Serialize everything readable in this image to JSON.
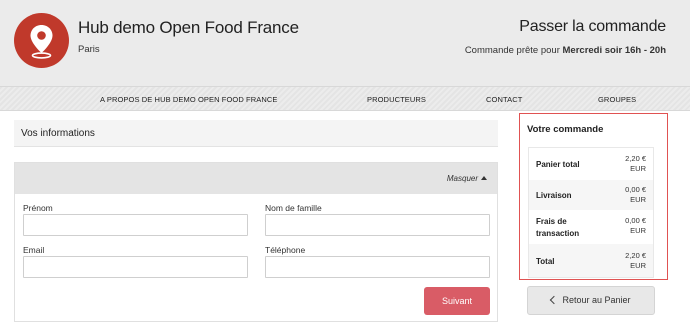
{
  "header": {
    "hub_name": "Hub demo Open Food France",
    "hub_city": "Paris",
    "checkout_title": "Passer la commande",
    "ready_prefix": "Commande prête pour",
    "ready_time": "Mercredi soir 16h - 20h",
    "logo_color": "#c0392b"
  },
  "nav": {
    "items": [
      {
        "label": "A PROPOS DE HUB DEMO OPEN FOOD FRANCE"
      },
      {
        "label": "PRODUCTEURS"
      },
      {
        "label": "CONTACT"
      },
      {
        "label": "GROUPES"
      }
    ]
  },
  "info": {
    "title": "Vos informations",
    "hide_label": "Masquer",
    "fields": {
      "first_name": {
        "label": "Prénom",
        "value": ""
      },
      "last_name": {
        "label": "Nom de famille",
        "value": ""
      },
      "email": {
        "label": "Email",
        "value": ""
      },
      "phone": {
        "label": "Téléphone",
        "value": ""
      }
    },
    "next_label": "Suivant",
    "next_color": "#d95c66"
  },
  "order": {
    "title": "Votre commande",
    "border_color": "#e05252",
    "rows": [
      {
        "label": "Panier total",
        "value_line1": "2,20 €",
        "value_line2": "EUR"
      },
      {
        "label": "Livraison",
        "value_line1": "0,00 €",
        "value_line2": "EUR"
      },
      {
        "label_line1": "Frais de",
        "label_line2": "transaction",
        "value_line1": "0,00 €",
        "value_line2": "EUR"
      },
      {
        "label": "Total",
        "value_line1": "2,20 €",
        "value_line2": "EUR"
      }
    ],
    "back_label": "Retour au Panier"
  }
}
